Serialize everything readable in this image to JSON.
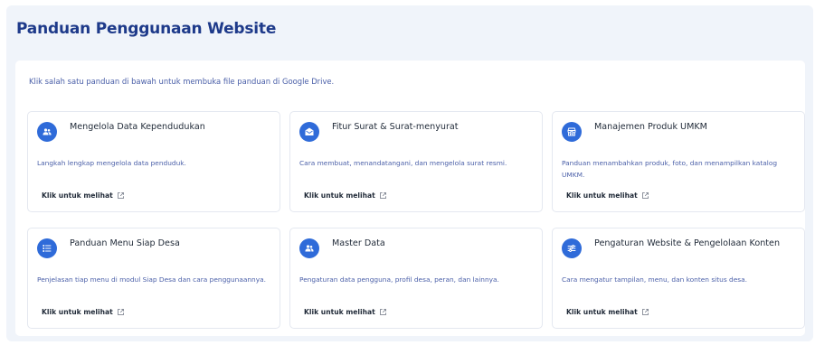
{
  "header": {
    "title": "Panduan Penggunaan Website"
  },
  "intro": "Klik salah satu panduan di bawah untuk membuka file panduan di Google Drive.",
  "colors": {
    "accent": "#2f6bd9",
    "title": "#1e3a8a",
    "muted_text": "#4a5fa8",
    "panel_bg": "#f0f4fa"
  },
  "cards": [
    {
      "icon": "users-icon",
      "title": "Mengelola Data Kependudukan",
      "description": "Langkah lengkap mengelola data penduduk.",
      "link": "Klik untuk melihat",
      "link_icon": "external-link-icon"
    },
    {
      "icon": "mail-icon",
      "title": "Fitur Surat & Surat-menyurat",
      "description": "Cara membuat, menandatangani, dan mengelola surat resmi.",
      "link": "Klik untuk melihat",
      "link_icon": "external-link-icon"
    },
    {
      "icon": "store-icon",
      "title": "Manajemen Produk UMKM",
      "description": "Panduan menambahkan produk, foto, dan menampilkan katalog UMKM.",
      "link": "Klik untuk melihat",
      "link_icon": "external-link-icon"
    },
    {
      "icon": "list-icon",
      "title": "Panduan Menu Siap Desa",
      "description": "Penjelasan tiap menu di modul Siap Desa dan cara penggunaannya.",
      "link": "Klik untuk melihat",
      "link_icon": "external-link-icon"
    },
    {
      "icon": "users-icon",
      "title": "Master Data",
      "description": "Pengaturan data pengguna, profil desa, peran, dan lainnya.",
      "link": "Klik untuk melihat",
      "link_icon": "external-link-icon"
    },
    {
      "icon": "sliders-icon",
      "title": "Pengaturan Website & Pengelolaan Konten",
      "description": "Cara mengatur tampilan, menu, dan konten situs desa.",
      "link": "Klik untuk melihat",
      "link_icon": "external-link-icon"
    }
  ]
}
